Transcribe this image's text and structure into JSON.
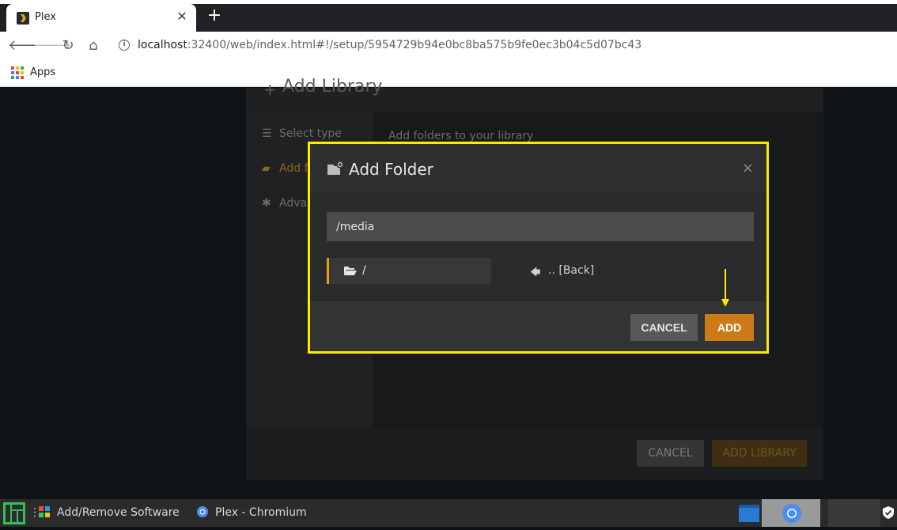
{
  "browser": {
    "tab_title": "Plex",
    "tab_close": "✕",
    "new_tab": "+",
    "url_host": "localhost",
    "url_rest": ":32400/web/index.html#!/setup/5954729b94e0bc8ba575b9fe0ec3b04c5d07bc43",
    "bookmarks_apps": "Apps"
  },
  "library_dialog": {
    "title": "Add Library",
    "sidebar": [
      {
        "label": "Select type"
      },
      {
        "label": "Add folders"
      },
      {
        "label": "Advanced"
      }
    ],
    "hint": "Add folders to your library",
    "cancel_label": "CANCEL",
    "add_library_label": "ADD LIBRARY"
  },
  "add_folder_modal": {
    "title": "Add Folder",
    "close": "×",
    "path_value": "/media",
    "directory_item": "/",
    "back_item": ".. [Back]",
    "cancel_label": "CANCEL",
    "add_label": "ADD",
    "highlight_color": "#ffeb00",
    "accent_color": "#cc7b19"
  },
  "taskbar": {
    "items": [
      {
        "label": "Add/Remove Software",
        "icon": "software-manager-icon"
      },
      {
        "label": "Plex - Chromium",
        "icon": "chromium-icon"
      }
    ]
  }
}
